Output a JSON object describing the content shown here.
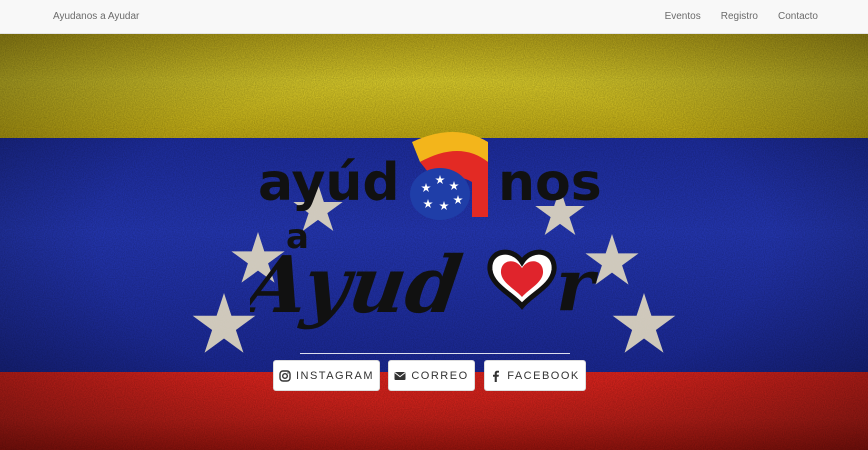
{
  "navbar": {
    "brand": "Ayudanos a Ayudar",
    "links": [
      "Eventos",
      "Registro",
      "Contacto"
    ]
  },
  "logo": {
    "line1_left": "ayúd",
    "line1_right": "nos",
    "line2_small": "a",
    "line2_script": "Ayud",
    "line2_tail": "r"
  },
  "buttons": {
    "instagram": "INSTAGRAM",
    "correo": "CORREO",
    "facebook": "FACEBOOK"
  },
  "colors": {
    "flag_yellow": "#d6c82a",
    "flag_blue": "#2436b0",
    "flag_red": "#d8231d",
    "heart": "#e0242c"
  },
  "icons": [
    "instagram-icon",
    "envelope-icon",
    "facebook-icon"
  ]
}
